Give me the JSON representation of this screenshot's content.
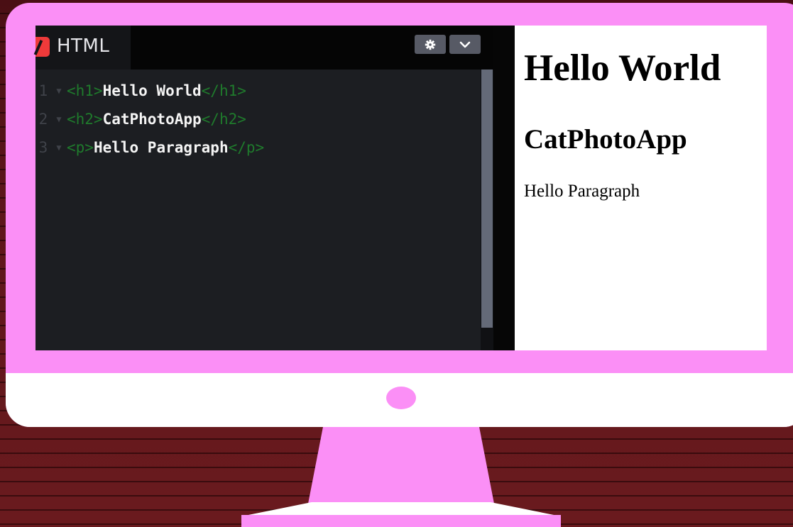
{
  "colors": {
    "monitor": "#fb8ff6",
    "background": "#5e171b",
    "editor_bg": "#1c1e22",
    "tag": "#1f7a2c"
  },
  "editor": {
    "tab_label": "HTML",
    "tab_icon": "html-logo-icon",
    "settings_icon": "gear-icon",
    "menu_icon": "chevron-down-icon",
    "lines": [
      {
        "number": "1",
        "open_tag": "<h1>",
        "text": "Hello World",
        "close_tag": "</h1>"
      },
      {
        "number": "2",
        "open_tag": "<h2>",
        "text": "CatPhotoApp",
        "close_tag": "</h2>"
      },
      {
        "number": "3",
        "open_tag": "<p>",
        "text": "Hello Paragraph",
        "close_tag": "</p>"
      }
    ]
  },
  "preview": {
    "h1": "Hello World",
    "h2": "CatPhotoApp",
    "p": "Hello Paragraph"
  }
}
